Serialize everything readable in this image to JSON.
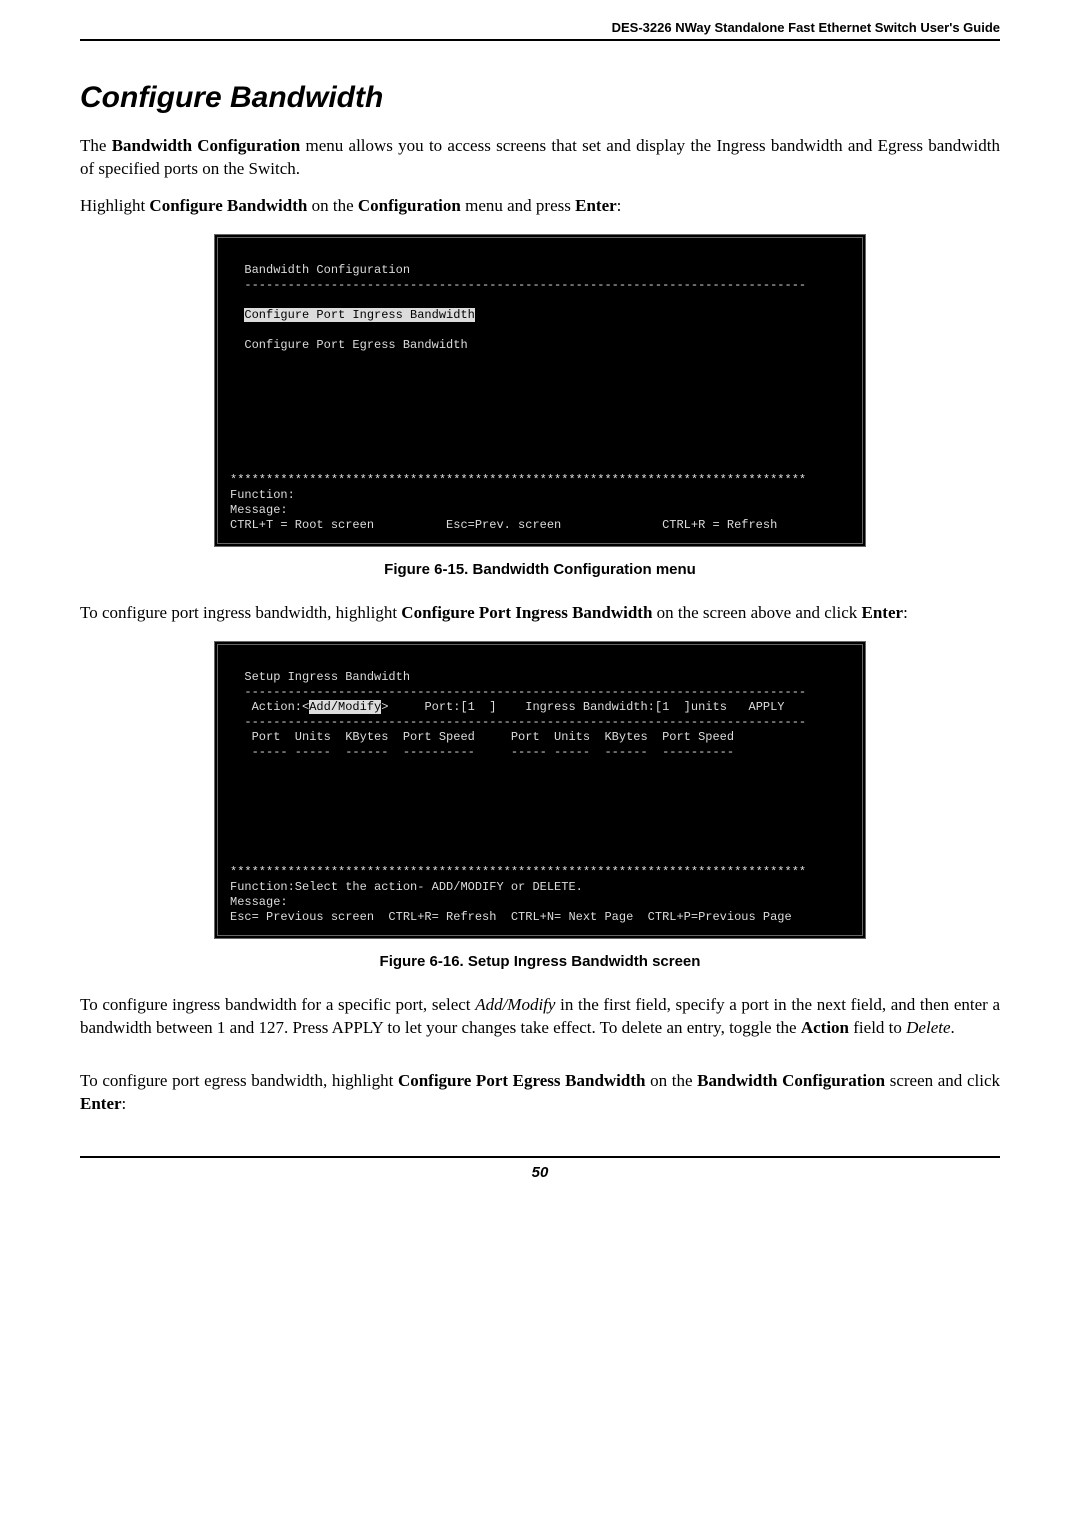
{
  "header": {
    "guide": "DES-3226 NWay Standalone Fast Ethernet Switch User's Guide"
  },
  "title": "Configure Bandwidth",
  "p1a": "The ",
  "p1b": "Bandwidth Configuration",
  "p1c": " menu allows you to access screens that set and display the Ingress bandwidth and Egress bandwidth of specified ports on the Switch.",
  "p2a": "Highlight ",
  "p2b": "Configure Bandwidth",
  "p2c": " on the ",
  "p2d": "Configuration",
  "p2e": " menu and press ",
  "p2f": "Enter",
  "p2g": ":",
  "term1": {
    "l1": "  Bandwidth Configuration",
    "l2": "  ------------------------------------------------------------------------------",
    "l3": "  ",
    "l3hl": "Configure Port Ingress Bandwidth",
    "l4": "  Configure Port Egress Bandwidth",
    "stars": "********************************************************************************",
    "fn": "Function:",
    "msg": "Message:",
    "foot": "CTRL+T = Root screen          Esc=Prev. screen              CTRL+R = Refresh"
  },
  "cap1": "Figure 6-15.  Bandwidth Configuration menu",
  "p3a": "To configure port ingress bandwidth, highlight ",
  "p3b": "Configure Port Ingress Bandwidth",
  "p3c": " on the screen above and click ",
  "p3d": "Enter",
  "p3e": ":",
  "term2": {
    "l1": "  Setup Ingress Bandwidth",
    "l2": "  ------------------------------------------------------------------------------",
    "l3a": "   Action:<",
    "l3hl": "Add/Modify",
    "l3b": ">     Port:[1  ]    Ingress Bandwidth:[1  ]units   APPLY",
    "l4": "  ------------------------------------------------------------------------------",
    "l5": "   Port  Units  KBytes  Port Speed     Port  Units  KBytes  Port Speed",
    "l6": "   ----- -----  ------  ----------     ----- -----  ------  ----------",
    "stars": "********************************************************************************",
    "fn": "Function:Select the action- ADD/MODIFY or DELETE.",
    "msg": "Message:",
    "foot": "Esc= Previous screen  CTRL+R= Refresh  CTRL+N= Next Page  CTRL+P=Previous Page"
  },
  "cap2": "Figure 6-16.  Setup Ingress Bandwidth screen",
  "p4a": "To configure ingress bandwidth for a specific port, select ",
  "p4b": "Add/Modify",
  "p4c": " in the first field, specify a port in the next field, and then enter a bandwidth between 1 and 127. Press APPLY to let your changes take effect. To delete an entry, toggle the ",
  "p4d": "Action",
  "p4e": " field to ",
  "p4f": "Delete",
  "p4g": ".",
  "p5a": "To configure port egress bandwidth, highlight ",
  "p5b": "Configure Port Egress Bandwidth",
  "p5c": " on the ",
  "p5d": "Bandwidth Configuration",
  "p5e": " screen and click ",
  "p5f": "Enter",
  "p5g": ":",
  "pagenum": "50"
}
